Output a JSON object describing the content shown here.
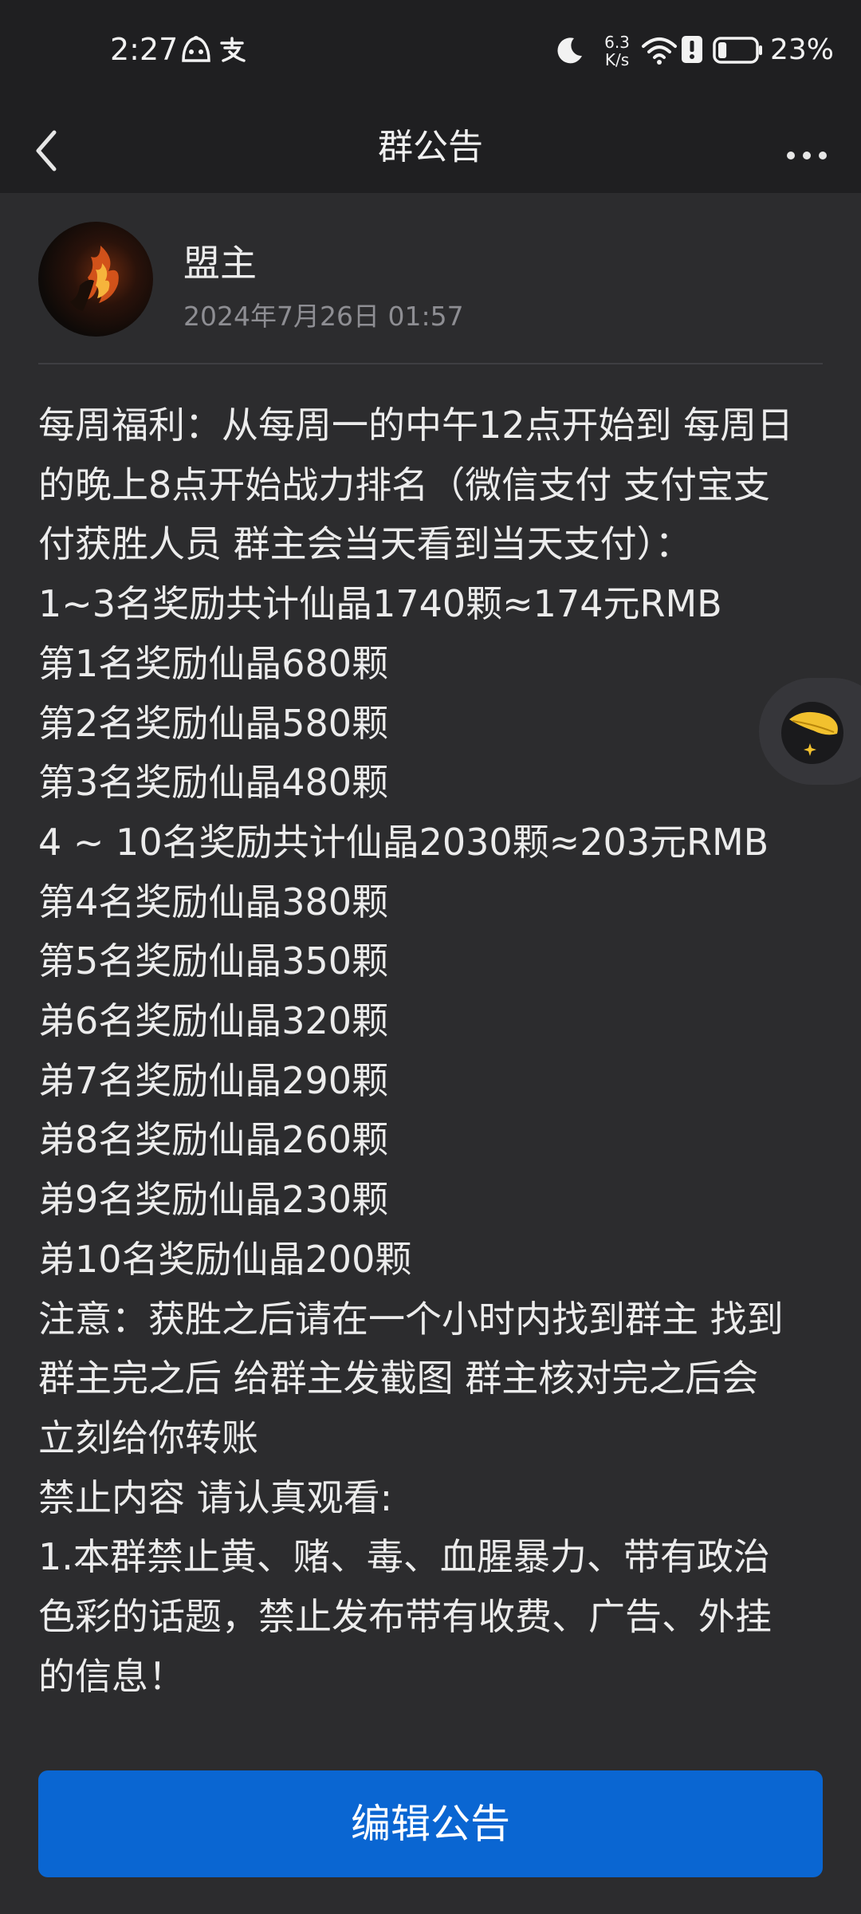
{
  "status_bar": {
    "time": "2:27",
    "net_speed_value": "6.3",
    "net_speed_unit": "K/s",
    "battery_percent": "23%",
    "battery_level": 0.23,
    "icons": [
      "baby-face-icon",
      "alipay-icon",
      "moon-icon",
      "wifi-icon",
      "alert-icon",
      "battery-icon"
    ]
  },
  "header": {
    "title": "群公告",
    "back_icon": "chevron-left-icon",
    "more_icon": "more-dots-icon"
  },
  "announcement": {
    "author": "盟主",
    "date": "2024年7月26日 01:57",
    "lines": [
      "每周福利：从每周一的中午12点开始到 每周日",
      "的晚上8点开始战力排名（微信支付 支付宝支",
      "付获胜人员 群主会当天看到当天支付）：",
      "1~3名奖励共计仙晶1740颗≈174元RMB",
      "第1名奖励仙晶680颗",
      "第2名奖励仙晶580颗",
      "第3名奖励仙晶480颗",
      "4 ~ 10名奖励共计仙晶2030颗≈203元RMB",
      "第4名奖励仙晶380颗",
      "第5名奖励仙晶350颗",
      "弟6名奖励仙晶320颗",
      "弟7名奖励仙晶290颗",
      "弟8名奖励仙晶260颗",
      "弟9名奖励仙晶230颗",
      "弟10名奖励仙晶200颗",
      "注意：获胜之后请在一个小时内找到群主 找到",
      "群主完之后 给群主发截图 群主核对完之后会",
      "立刻给你转账",
      "禁止内容 请认真观看:",
      "1.本群禁止黄、赌、毒、血腥暴力、带有政治",
      "色彩的话题，禁止发布带有收费、广告、外挂",
      "的信息！"
    ]
  },
  "floating_button": {
    "icon": "feather-icon",
    "accent": "#f2c12e"
  },
  "footer": {
    "edit_label": "编辑公告",
    "button_color": "#0a66d2"
  }
}
